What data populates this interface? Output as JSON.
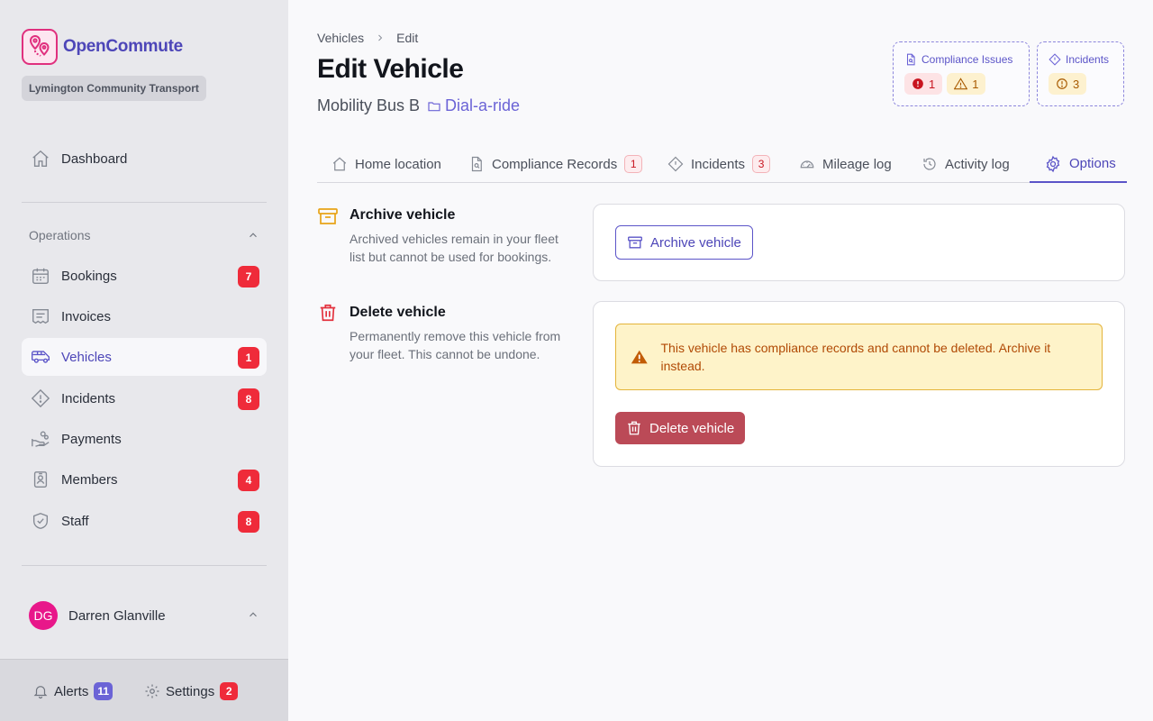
{
  "app": {
    "name": "OpenCommute",
    "organization": "Lymington Community Transport"
  },
  "sidebar": {
    "items": [
      {
        "key": "dashboard",
        "label": "Dashboard",
        "icon": "home-icon",
        "badge": ""
      },
      {
        "key": "bookings",
        "label": "Bookings",
        "icon": "calendar-icon",
        "badge": "7"
      },
      {
        "key": "invoices",
        "label": "Invoices",
        "icon": "invoice-icon",
        "badge": ""
      },
      {
        "key": "vehicles",
        "label": "Vehicles",
        "icon": "van-icon",
        "badge": "1",
        "active": true
      },
      {
        "key": "incidents",
        "label": "Incidents",
        "icon": "warning-diamond-icon",
        "badge": "8"
      },
      {
        "key": "payments",
        "label": "Payments",
        "icon": "hand-coins-icon",
        "badge": ""
      },
      {
        "key": "members",
        "label": "Members",
        "icon": "id-badge-icon",
        "badge": "4"
      },
      {
        "key": "staff",
        "label": "Staff",
        "icon": "shield-check-icon",
        "badge": "8"
      }
    ],
    "section_label": "Operations",
    "user": {
      "initials": "DG",
      "name": "Darren Glanville"
    },
    "footer": {
      "alerts_label": "Alerts",
      "alerts_count": "11",
      "settings_label": "Settings",
      "settings_count": "2"
    }
  },
  "breadcrumb": {
    "parent": "Vehicles",
    "current": "Edit"
  },
  "page": {
    "title": "Edit Vehicle",
    "vehicle_name": "Mobility Bus B",
    "vehicle_group": "Dial-a-ride"
  },
  "status": {
    "compliance": {
      "label": "Compliance Issues",
      "error_count": "1",
      "warning_count": "1"
    },
    "incidents": {
      "label": "Incidents",
      "count": "3"
    }
  },
  "tabs": [
    {
      "label": "Home location",
      "icon": "home-icon",
      "badge": ""
    },
    {
      "label": "Compliance Records",
      "icon": "document-search-icon",
      "badge": "1"
    },
    {
      "label": "Incidents",
      "icon": "warning-diamond-icon",
      "badge": "3"
    },
    {
      "label": "Mileage log",
      "icon": "gauge-icon",
      "badge": ""
    },
    {
      "label": "Activity log",
      "icon": "history-icon",
      "badge": ""
    },
    {
      "label": "Options",
      "icon": "gear-icon",
      "badge": "",
      "active": true
    }
  ],
  "archive": {
    "title": "Archive vehicle",
    "description": "Archived vehicles remain in your fleet list but cannot be used for bookings.",
    "button_label": "Archive vehicle"
  },
  "delete": {
    "title": "Delete vehicle",
    "description": "Permanently remove this vehicle from your fleet. This cannot be undone.",
    "warning": "This vehicle has compliance records and cannot be deleted. Archive it instead.",
    "button_label": "Delete vehicle"
  },
  "colors": {
    "brand": "#4d46b8",
    "accent": "#e0307e",
    "badge_red": "#ef2b3a",
    "danger_button": "#bb4a57",
    "warning_bg": "#fef3c9",
    "archive_icon": "#e8a317"
  }
}
